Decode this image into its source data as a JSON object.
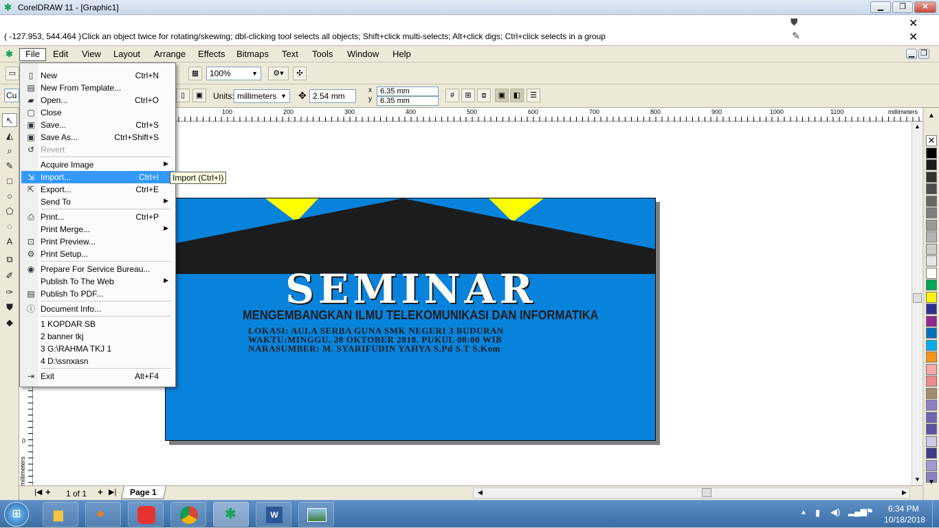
{
  "window": {
    "title": "CorelDRAW 11 - [Graphic1]"
  },
  "status": {
    "coords": "( -127.953, 544.464 )",
    "hint": "Click an object twice for rotating/skewing; dbl-clicking tool selects all objects; Shift+click multi-selects; Alt+click digs; Ctrl+click selects in a group"
  },
  "menubar": [
    "File",
    "Edit",
    "View",
    "Layout",
    "Arrange",
    "Effects",
    "Bitmaps",
    "Text",
    "Tools",
    "Window",
    "Help"
  ],
  "toolbar": {
    "zoom": "100%",
    "units_label": "Units:",
    "units_value": "millimeters",
    "nudge": "2.54 mm",
    "dup_x": "6.35 mm",
    "dup_y": "6.35 mm",
    "dup_x_label": "x",
    "dup_y_label": "y",
    "left_stub": "Cu"
  },
  "file_menu": [
    {
      "label": "New",
      "shortcut": "Ctrl+N",
      "icon": "new-doc-icon"
    },
    {
      "label": "New From Template...",
      "shortcut": "",
      "icon": "template-icon"
    },
    {
      "label": "Open...",
      "shortcut": "Ctrl+O",
      "icon": "open-folder-icon"
    },
    {
      "label": "Close",
      "shortcut": "",
      "icon": "close-doc-icon"
    },
    {
      "label": "Save...",
      "shortcut": "Ctrl+S",
      "icon": "save-icon"
    },
    {
      "label": "Save As...",
      "shortcut": "Ctrl+Shift+S",
      "icon": "save-as-icon"
    },
    {
      "label": "Revert",
      "shortcut": "",
      "icon": "revert-icon",
      "disabled": true
    },
    {
      "label": "Acquire Image",
      "shortcut": "",
      "submenu": true
    },
    {
      "label": "Import...",
      "shortcut": "Ctrl+I",
      "icon": "import-icon",
      "highlight": true
    },
    {
      "label": "Export...",
      "shortcut": "Ctrl+E",
      "icon": "export-icon"
    },
    {
      "label": "Send To",
      "shortcut": "",
      "submenu": true
    },
    {
      "label": "Print...",
      "shortcut": "Ctrl+P",
      "icon": "print-icon"
    },
    {
      "label": "Print Merge...",
      "shortcut": "",
      "submenu": true
    },
    {
      "label": "Print Preview...",
      "shortcut": "",
      "icon": "print-preview-icon"
    },
    {
      "label": "Print Setup...",
      "shortcut": "",
      "icon": "print-setup-icon"
    },
    {
      "label": "Prepare For Service Bureau...",
      "shortcut": "",
      "icon": "service-bureau-icon"
    },
    {
      "label": "Publish To The Web",
      "shortcut": "",
      "submenu": true
    },
    {
      "label": "Publish To PDF...",
      "shortcut": "",
      "icon": "pdf-icon"
    },
    {
      "label": "Document Info...",
      "shortcut": "",
      "icon": "info-icon"
    },
    {
      "label": "1 KOPDAR SB",
      "shortcut": ""
    },
    {
      "label": "2 banner tkj",
      "shortcut": ""
    },
    {
      "label": "3 G:\\RAHMA TKJ 1",
      "shortcut": ""
    },
    {
      "label": "4 D:\\ssnxasn",
      "shortcut": ""
    },
    {
      "label": "Exit",
      "shortcut": "Alt+F4",
      "icon": "exit-icon"
    }
  ],
  "tooltip": "Import (Ctrl+I)",
  "ruler": {
    "unit": "millimeters",
    "ticks": [
      "100",
      "200",
      "300",
      "400",
      "500",
      "600",
      "700",
      "800",
      "900",
      "1000",
      "1100"
    ],
    "v_label": "millimeters",
    "v_zero": "0"
  },
  "poster": {
    "title": "SEMINAR",
    "subtitle": "MENGEMBANGKAN ILMU TELEKOMUNIKASI DAN INFORMATIKA",
    "line1": "LOKASI: AULA SERBA GUNA SMK NEGERI 3 BUDURAN",
    "line2": "WAKTU:MINGGU, 28 OKTOBER 2018. PUKUL  08:00 WIB",
    "line3": "NARASUMBER: M. SYARIFUDIN YAHYA S.Pd S.T S.Kom",
    "colors": {
      "bg": "#0883db",
      "band": "#1b1c1e",
      "accent": "#ffff00"
    }
  },
  "pages": {
    "counter": "1 of 1",
    "tab": "Page 1"
  },
  "palette": [
    "#ffffff",
    "#000000",
    "#1a1a1a",
    "#333333",
    "#4d4d4d",
    "#666666",
    "#808080",
    "#999999",
    "#b3b3b3",
    "#cccccc",
    "#e6e6e6",
    "#ffffff",
    "#00a651",
    "#fff200",
    "#2e3192",
    "#92278f",
    "#0072bc",
    "#00aeef",
    "#f7941d",
    "#f9a8a8",
    "#ed8b8b",
    "#a38b6c",
    "#8f7fc2",
    "#6d64b5",
    "#5a52a6",
    "#ccc9e8",
    "#3f3a8a",
    "#9e9ad0",
    "#8a82c4"
  ],
  "taskbar": {
    "time": "6:34 PM",
    "date": "10/18/2018"
  }
}
